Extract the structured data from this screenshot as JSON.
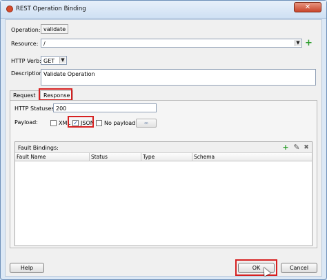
{
  "window": {
    "title": "REST Operation Binding",
    "close_symbol": "✕"
  },
  "form": {
    "operation_label": "Operation:",
    "operation_value": "validate",
    "resource_label": "Resource:",
    "resource_value": "/",
    "http_verb_label": "HTTP Verb:",
    "http_verb_value": "GET",
    "description_label": "Description:",
    "description_value": "Validate Operation"
  },
  "tabs": [
    {
      "label": "Request",
      "active": false
    },
    {
      "label": "Response",
      "active": true
    }
  ],
  "response": {
    "http_statuses_label": "HTTP Statuses:",
    "http_statuses_value": "200",
    "payload_label": "Payload:",
    "payload_options": [
      {
        "label": "XML",
        "checked": false
      },
      {
        "label": "JSON",
        "checked": true
      },
      {
        "label": "No payload",
        "checked": false
      }
    ],
    "fault_bindings_label": "Fault Bindings:",
    "columns": [
      "Fault Name",
      "Status",
      "Type",
      "Schema"
    ],
    "rows": []
  },
  "footer": {
    "help_label": "Help",
    "ok_label": "OK",
    "cancel_label": "Cancel"
  },
  "icons": {
    "add": "+",
    "edit": "✎",
    "delete": "✖",
    "dropdown": "▼",
    "check": "✓",
    "link": "∞"
  },
  "colors": {
    "highlight": "#d62020",
    "add_green": "#2a9d2a",
    "title_close": "#c8452b"
  }
}
